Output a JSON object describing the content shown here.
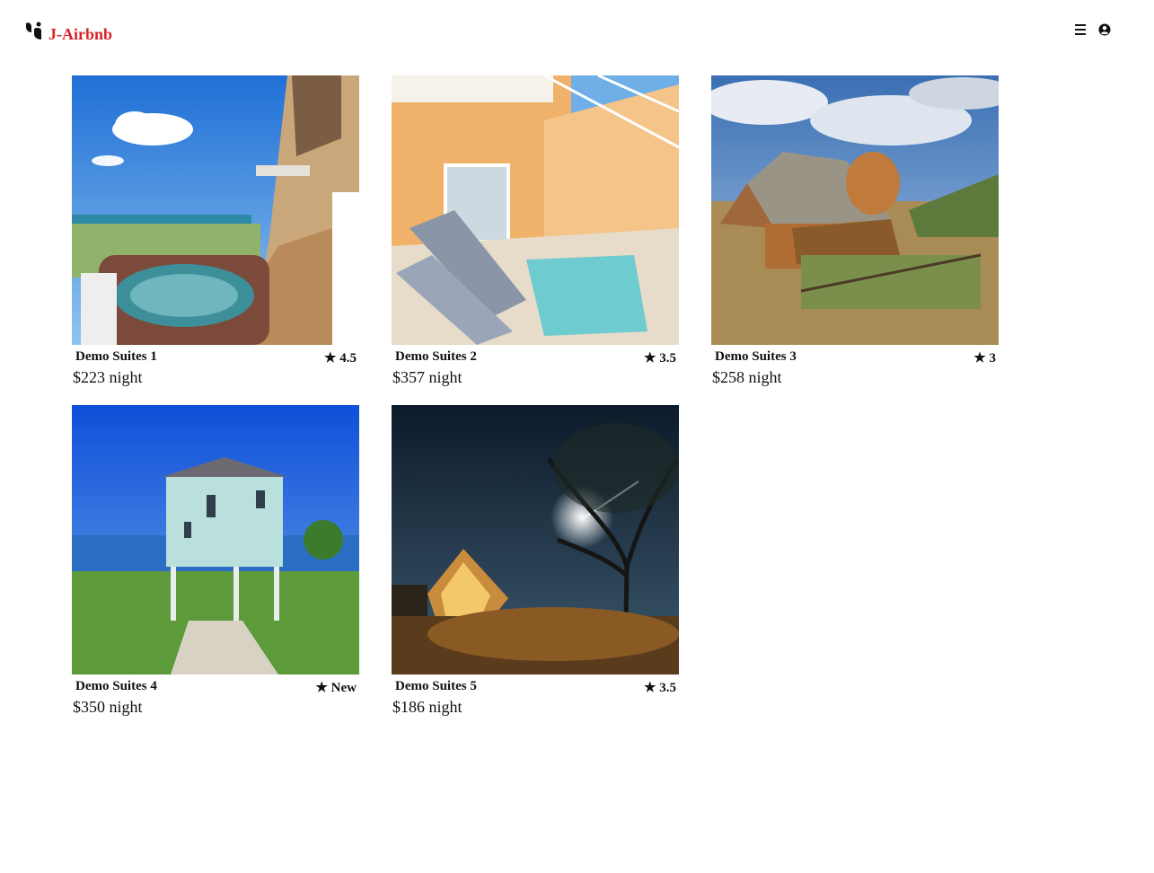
{
  "header": {
    "brand": "J-Airbnb"
  },
  "listings": [
    {
      "name": "Demo Suites 1",
      "rating": "★ 4.5",
      "price": "$223 night"
    },
    {
      "name": "Demo Suites 2",
      "rating": "★ 3.5",
      "price": "$357 night"
    },
    {
      "name": "Demo Suites 3",
      "rating": "★ 3",
      "price": "$258 night"
    },
    {
      "name": "Demo Suites 4",
      "rating": "★ New",
      "price": "$350 night"
    },
    {
      "name": "Demo Suites 5",
      "rating": "★ 3.5",
      "price": "$186 night"
    }
  ],
  "icons": {
    "logo": "airbnb-logo-icon",
    "menu": "hamburger-menu-icon",
    "user": "user-account-icon"
  },
  "colors": {
    "brand": "#d8232a"
  }
}
